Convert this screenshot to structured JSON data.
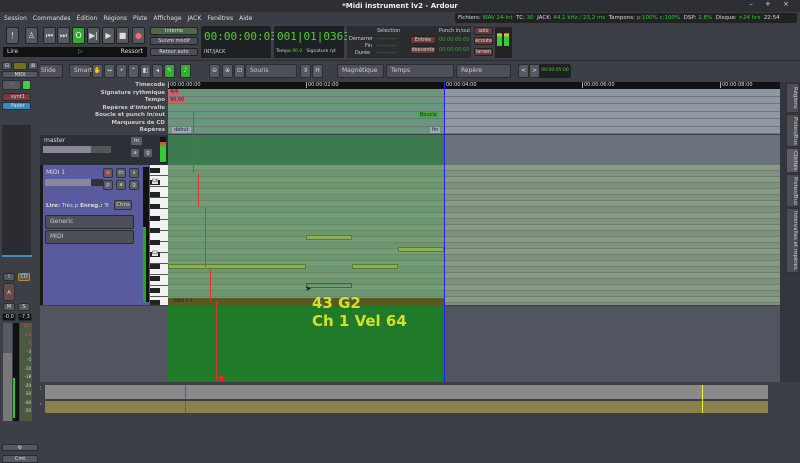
{
  "window": {
    "title": "*Midi instrument lv2 - Ardour",
    "controls": "– + ×"
  },
  "menu": [
    "Session",
    "Commandes",
    "Édition",
    "Régions",
    "Piste",
    "Affichage",
    "JACK",
    "Fenêtres",
    "Aide"
  ],
  "status": {
    "files_label": "Fichiers:",
    "files": "WAV 24-int",
    "tc_label": "TC:",
    "tc": "30",
    "jack_label": "JACK:",
    "jack": "44,1 kHz / 23,2 ms",
    "buffers_label": "Tampons:",
    "buffers": "p:100% c:100%",
    "dsp_label": "DSP:",
    "dsp": "2,8%",
    "disk_label": "Disque:",
    "disk": ">24 hrs",
    "time": "22:54"
  },
  "transport": {
    "play_label": "Lire",
    "ressort": "Ressort",
    "interne": "Interne",
    "suivre": "Suivre modif",
    "retour": "Retour auto",
    "timecode": "00:00:00:03",
    "source": "INT/JACK",
    "bbt": "001|01|0363",
    "tempo_label": "Tempo",
    "tempo": "90.0",
    "signature_label": "Signature ryt",
    "selection": {
      "title": "Sélection",
      "start": "Démarrer",
      "end": "Fin",
      "duration": "Durée",
      "empty": "--:--:--:--"
    },
    "punch": {
      "title": "Punch in/out",
      "in": "Entrée",
      "out": "descente",
      "in_time": "00:00:00:00",
      "out_time": "00:00:00:00"
    },
    "solo": "solo",
    "ecoute": "écoute",
    "larsen": "larsen"
  },
  "edit_toolbar": {
    "edit_mode": "Slide",
    "smart": "Smart",
    "mouse": "Souris",
    "snap": "Magnétique",
    "grid": "Temps",
    "ref": "Repère",
    "nudge_clock": "00:00:05:00"
  },
  "rulers": {
    "labels": [
      "Timecode",
      "Signature rythmique",
      "Tempo",
      "Repères d'intervalle",
      "Boucle et punch in/out",
      "Marqueurs de CD",
      "Repères"
    ],
    "ticks": [
      "00:00:00:00",
      "00:00:02:00",
      "00:00:04:00",
      "00:00:06:00",
      "00:00:08:00"
    ],
    "meter": "4/4",
    "tempo_marker": "90,00",
    "loop": "Boucle",
    "start": "début",
    "end": "fin"
  },
  "tracks": {
    "master": {
      "name": "master",
      "m": "m",
      "a": "a",
      "g": "g"
    },
    "midi": {
      "name": "MIDI 1",
      "m": "m",
      "s": "s",
      "p": "p",
      "a": "a",
      "g": "g",
      "play": "Lire:",
      "play_val": "Très.p",
      "rec": "Enreg.:",
      "rec_val": "Tr",
      "chns": "Chns",
      "instrument": "Generic",
      "mode": "MIDI",
      "region": "MIDI 1-1",
      "c4": "C4",
      "c3": "C3"
    }
  },
  "note_info": {
    "line1": "43 G2",
    "line2": "Ch 1 Vel 64"
  },
  "side_tabs": [
    "Régions",
    "Pistes/Bus",
    "Clichés",
    "Pistes/Bus",
    "Intervalles et repères"
  ],
  "mixer_strip": {
    "name": "MIDI",
    "synth": "synt1",
    "fader": "Fader",
    "i": "I",
    "cd": "CD",
    "a": "A",
    "m": "M",
    "s": "S",
    "gain": "-0,0",
    "peak": "-7,3",
    "scale": [
      "127",
      "+3",
      "0",
      "-3",
      "-5",
      "-10",
      "-18",
      "-20",
      "-30",
      "-40",
      "-50"
    ],
    "cmt": "Cmt"
  }
}
